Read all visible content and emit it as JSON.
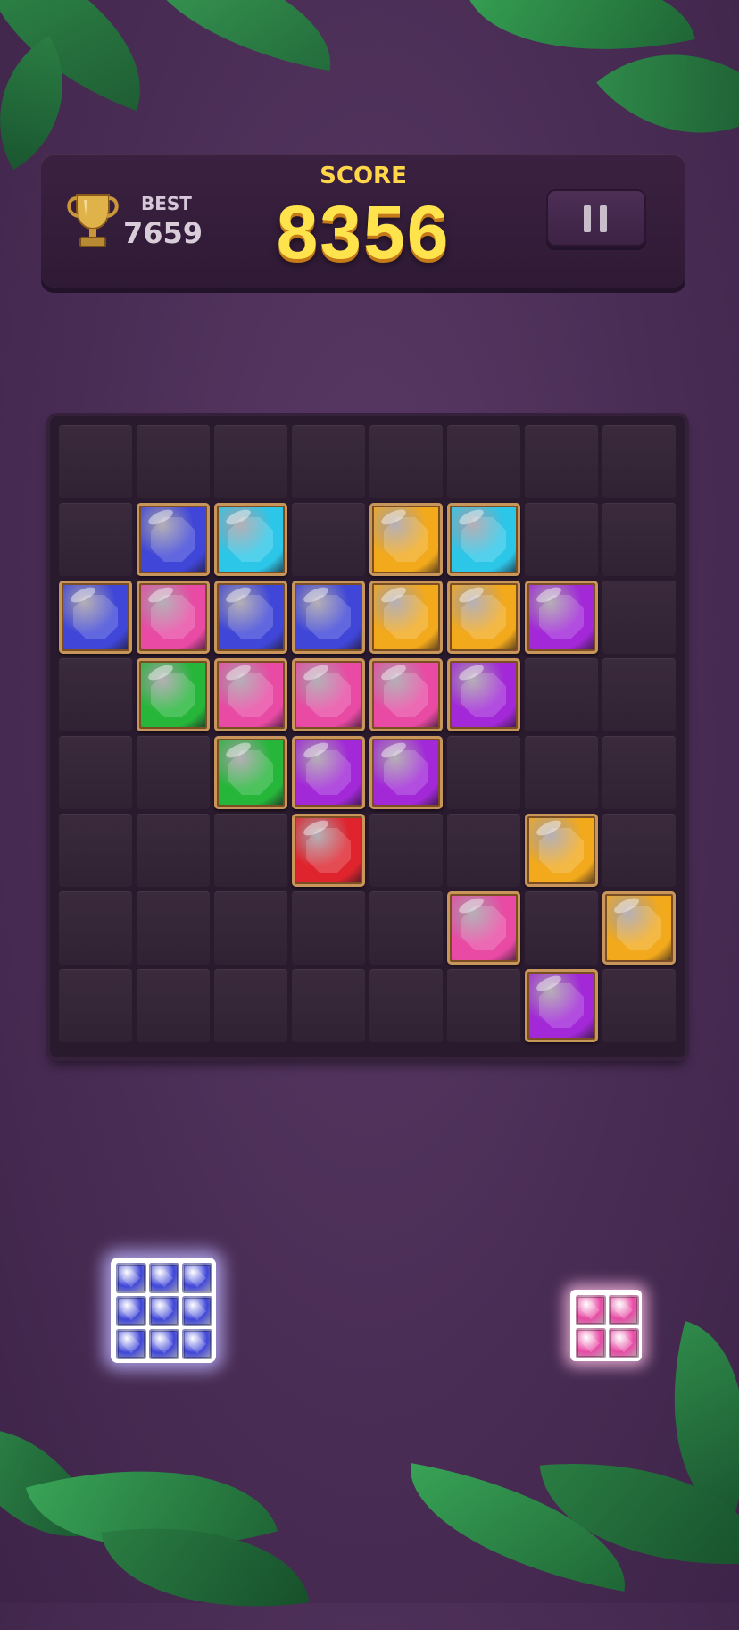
{
  "header": {
    "best_label": "BEST",
    "best_value": "7659",
    "score_label": "SCORE",
    "score_value": "8356",
    "pause_icon": "pause-icon",
    "trophy_icon": "trophy-icon"
  },
  "colors": {
    "blue": "#3f46d8",
    "cyan": "#2cc6e8",
    "orange": "#f2a91c",
    "pink": "#e84aa4",
    "purple": "#a228d8",
    "green": "#26b63a",
    "red": "#e0242e"
  },
  "board": {
    "rows": 8,
    "cols": 8,
    "grid": [
      [
        null,
        null,
        null,
        null,
        null,
        null,
        null,
        null
      ],
      [
        null,
        "blue",
        "cyan",
        null,
        "orange",
        "cyan",
        null,
        null
      ],
      [
        "blue",
        "pink",
        "blue",
        "blue",
        "orange",
        "orange",
        "purple",
        null
      ],
      [
        null,
        "green",
        "pink",
        "pink",
        "pink",
        "purple",
        null,
        null
      ],
      [
        null,
        null,
        "green",
        "purple",
        "purple",
        null,
        null,
        null
      ],
      [
        null,
        null,
        null,
        "red",
        null,
        null,
        "orange",
        null
      ],
      [
        null,
        null,
        null,
        null,
        null,
        "pink",
        null,
        "orange"
      ],
      [
        null,
        null,
        null,
        null,
        null,
        null,
        "purple",
        null
      ]
    ]
  },
  "pieces": [
    {
      "name": "piece-blue-3x3",
      "color": "blue",
      "rows": 3,
      "cols": 3
    },
    {
      "name": "piece-pink-2x2",
      "color": "pink",
      "rows": 2,
      "cols": 2
    }
  ]
}
